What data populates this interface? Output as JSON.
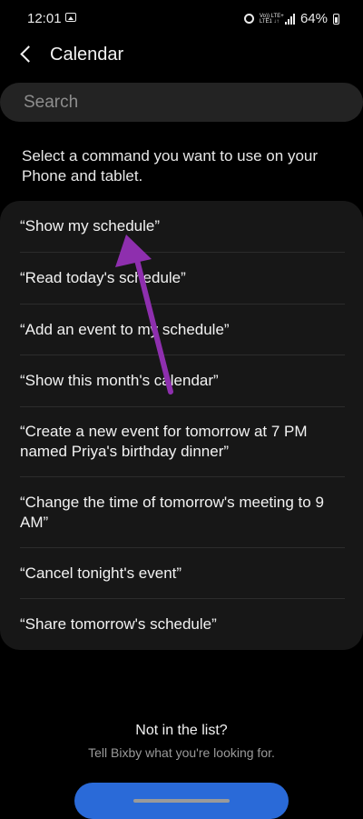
{
  "status_bar": {
    "time": "12:01",
    "network": "Vo)) LTE+\nLTE1 ↓↑",
    "battery": "64%",
    "icons": [
      "gallery-icon",
      "alarm-icon",
      "signal-icon",
      "battery-icon"
    ]
  },
  "header": {
    "title": "Calendar",
    "back_icon": "chevron-left-icon"
  },
  "search": {
    "placeholder": "Search"
  },
  "instruction": "Select a command you want to use on your Phone and tablet.",
  "commands": [
    "“Show my schedule”",
    "“Read today's schedule”",
    "“Add an event to my schedule”",
    "“Show this month's calendar”",
    "“Create a new event for tomorrow at 7 PM named Priya's birthday dinner”",
    "“Change the time of tomorrow's meeting to 9 AM”",
    "“Cancel tonight's event”",
    "“Share tomorrow's schedule”"
  ],
  "footer": {
    "title": "Not in the list?",
    "subtitle": "Tell Bixby what you're looking for."
  },
  "colors": {
    "background": "#000000",
    "card": "#171717",
    "search": "#232323",
    "annotation_arrow": "#8e2fae",
    "button": "#2a6ad8"
  }
}
